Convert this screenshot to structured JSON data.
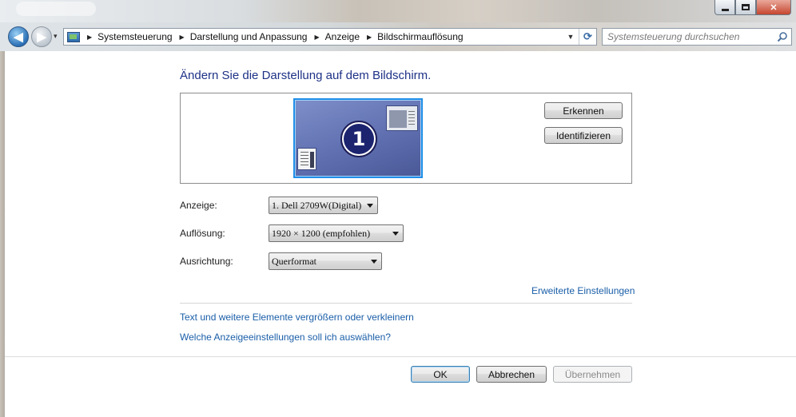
{
  "window": {
    "minimize_glyph": "",
    "maximize_glyph": "",
    "close_glyph": "✕"
  },
  "nav": {
    "back_glyph": "◀",
    "forward_glyph": "▶",
    "history_glyph": "▾",
    "breadcrumbs": [
      "Systemsteuerung",
      "Darstellung und Anpassung",
      "Anzeige",
      "Bildschirmauflösung"
    ],
    "breadcrumb_separator": "▶",
    "refresh_glyph": "⟳",
    "dropdown_glyph": "▼"
  },
  "search": {
    "placeholder": "Systemsteuerung durchsuchen"
  },
  "main": {
    "heading": "Ändern Sie die Darstellung auf dem Bildschirm.",
    "monitor_number": "1",
    "detect_button": "Erkennen",
    "identify_button": "Identifizieren",
    "display_label": "Anzeige:",
    "display_value": "1. Dell 2709W(Digital)",
    "resolution_label": "Auflösung:",
    "resolution_value": "1920 × 1200 (empfohlen)",
    "orientation_label": "Ausrichtung:",
    "orientation_value": "Querformat",
    "advanced_link": "Erweiterte Einstellungen",
    "text_size_link": "Text und weitere Elemente vergrößern oder verkleinern",
    "which_settings_link": "Welche Anzeigeeinstellungen soll ich auswählen?"
  },
  "footer": {
    "ok_button": "OK",
    "cancel_button": "Abbrechen",
    "apply_button": "Übernehmen"
  },
  "colors": {
    "heading": "#1e3287",
    "link": "#1a5ea8",
    "monitor_border": "#1f8ee8"
  }
}
